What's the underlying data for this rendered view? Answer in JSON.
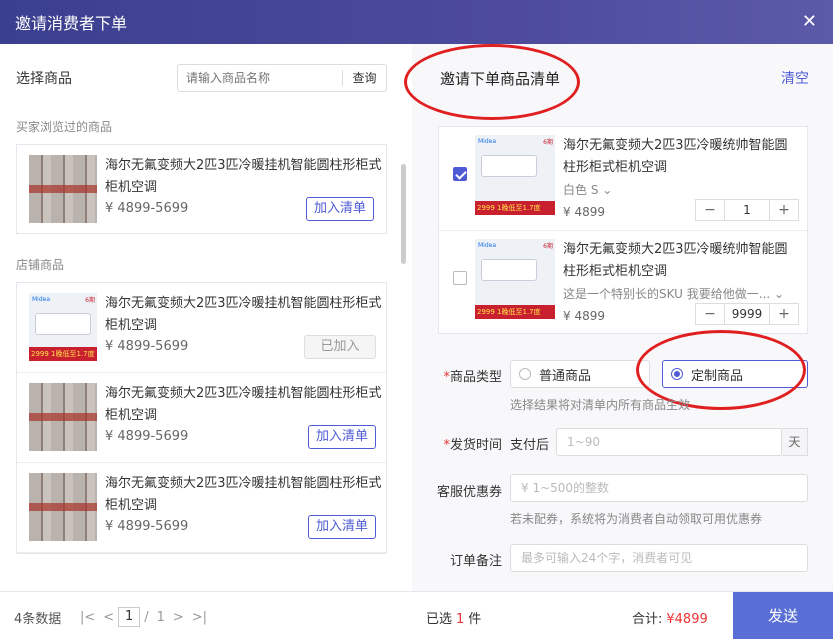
{
  "dialog": {
    "title": "邀请消费者下单"
  },
  "left": {
    "section_title": "选择商品",
    "search_placeholder": "请输入商品名称",
    "search_button": "查询",
    "group_browsed": "买家浏览过的商品",
    "group_store": "店铺商品",
    "browsed_items": [
      {
        "name": "海尔无氟变频大2匹3匹冷暖挂机智能圆柱形柜式柜机空调",
        "price": "¥ 4899-5699",
        "button": "加入清单"
      }
    ],
    "store_items": [
      {
        "name": "海尔无氟变频大2匹3匹冷暖挂机智能圆柱形柜式柜机空调",
        "price": "¥ 4899-5699",
        "button": "已加入"
      },
      {
        "name": "海尔无氟变频大2匹3匹冷暖挂机智能圆柱形柜式柜机空调",
        "price": "¥ 4899-5699",
        "button": "加入清单"
      },
      {
        "name": "海尔无氟变频大2匹3匹冷暖挂机智能圆柱形柜式柜机空调",
        "price": "¥ 4899-5699",
        "button": "加入清单"
      }
    ]
  },
  "right": {
    "title": "邀请下单商品清单",
    "clear": "清空",
    "cart": [
      {
        "name": "海尔无氟变频大2匹3匹冷暖统帅智能圆柱形柜式柜机空调",
        "sku": "白色 S",
        "price": "¥ 4899",
        "qty": "1",
        "checked": true
      },
      {
        "name": "海尔无氟变频大2匹3匹冷暖统帅智能圆柱形柜式柜机空调",
        "sku": "这是一个特别长的SKU 我要给他做一...",
        "price": "¥ 4899",
        "qty": "9999",
        "checked": false
      }
    ],
    "form": {
      "type_label": "商品类型",
      "type_normal": "普通商品",
      "type_custom": "定制商品",
      "type_hint": "选择结果将对清单内所有商品生效",
      "ship_label": "发货时间",
      "ship_prefix": "支付后",
      "ship_placeholder": "1~90",
      "ship_unit": "天",
      "coupon_label": "客服优惠券",
      "coupon_placeholder": "¥  1~500的整数",
      "coupon_hint": "若未配券，系统将为消费者自动领取可用优惠券",
      "remark_label": "订单备注",
      "remark_placeholder": "最多可输入24个字，消费者可见"
    }
  },
  "footer": {
    "count": "4条数据",
    "page_current": "1",
    "page_sep": "/",
    "page_total": "1",
    "selected_prefix": "已选",
    "selected_num": "1",
    "selected_suffix": "件",
    "total_label": "合计:",
    "total_amount": "¥4899",
    "send": "发送"
  },
  "product_image": {
    "badge": "2999 1晚低至1.7度",
    "brand": "Midea",
    "tag": "6期"
  },
  "colors": {
    "accent": "#4f5bd5",
    "header": "#3b3f8f",
    "send": "#5a6fd6",
    "highlight": "#e02020"
  }
}
